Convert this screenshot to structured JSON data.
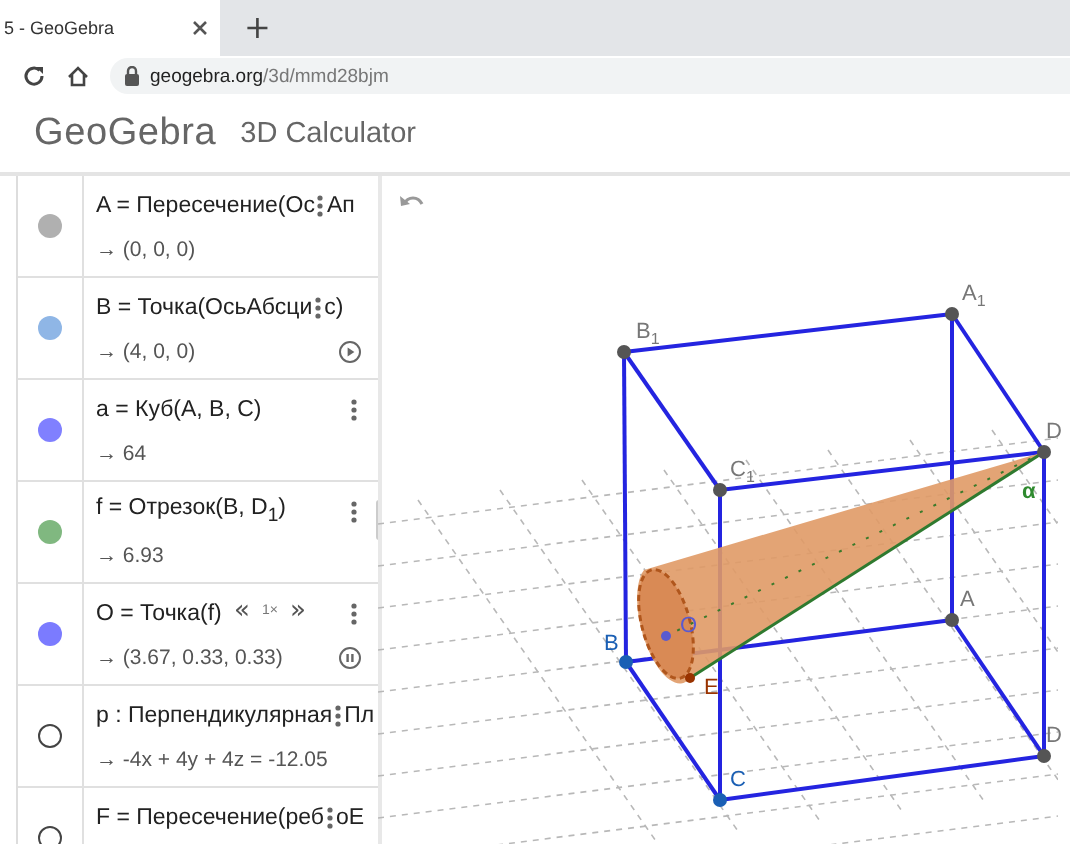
{
  "browser": {
    "tab_title": "5 - GeoGebra",
    "new_tab": "+",
    "url_host": "geogebra.org",
    "url_path": "/3d/mmd28bjm"
  },
  "app": {
    "logo": "GeoGebra",
    "title": "3D Calculator"
  },
  "algebra": [
    {
      "definition": "A = Пересечение(Ос",
      "definition_tail": "Ап",
      "value": "→ (0, 0, 0)",
      "visible": true,
      "color": "#b0b0b0"
    },
    {
      "definition": "B = Точка(ОсьАбсци",
      "definition_tail": "с)",
      "value": "→ (4, 0, 0)",
      "visible": true,
      "color": "#8fb6e6",
      "animating": false
    },
    {
      "definition": "a = Куб(A, B, C)",
      "value": "→ 64",
      "visible": true,
      "color": "#8080ff"
    },
    {
      "definition": "f = Отрезок(B, D$_{1}$)",
      "value": "→ 6.93",
      "visible": true,
      "color": "#80b880"
    },
    {
      "definition": "O = Точка(f)",
      "value": "→ (3.67, 0.33, 0.33)",
      "visible": true,
      "color": "#7b7bff",
      "animating": true,
      "speed": {
        "slower": "«",
        "rate": "1×",
        "faster": "»"
      }
    },
    {
      "definition": "p : Перпендикулярная",
      "definition_tail": "Пл",
      "value": "→ -4x + 4y + 4z = -12.05",
      "visible": false,
      "color": "#444444"
    },
    {
      "definition": "F = Пересечение(реб",
      "definition_tail": "оE",
      "visible": false,
      "color": "#444444"
    }
  ],
  "points": [
    {
      "label": "B$_{1}$",
      "color": "#555555"
    },
    {
      "label": "A$_{1}$",
      "color": "#555555"
    },
    {
      "label": "D",
      "color": "#555555"
    },
    {
      "label": "C$_{1}$",
      "color": "#555555"
    },
    {
      "label": "B",
      "color": "#1a5fb4"
    },
    {
      "label": "A",
      "color": "#555555"
    },
    {
      "label": "D",
      "color": "#555555"
    },
    {
      "label": "C",
      "color": "#1a5fb4"
    },
    {
      "label": "E",
      "color": "#993300"
    },
    {
      "label": "O",
      "color": "#5a5ad0"
    }
  ],
  "angle_label": "α"
}
